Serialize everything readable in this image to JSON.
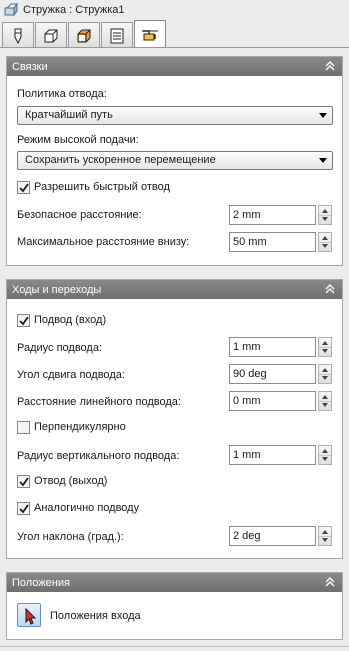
{
  "window": {
    "title": "Стружка : Стружка1"
  },
  "tabs": [
    {
      "icon": "tool-icon"
    },
    {
      "icon": "cube-icon"
    },
    {
      "icon": "stock-icon"
    },
    {
      "icon": "list-icon"
    },
    {
      "icon": "links-icon",
      "active": true
    }
  ],
  "links": {
    "title": "Связки",
    "retract_policy_label": "Политика отвода:",
    "retract_policy_value": "Кратчайший путь",
    "high_feed_label": "Режим высокой подачи:",
    "high_feed_value": "Сохранить ускоренное перемещение",
    "fast_retract_label": "Разрешить быстрый отвод",
    "fast_retract_checked": true,
    "safe_distance_label": "Безопасное расстояние:",
    "safe_distance_value": "2 mm",
    "max_down_label": "Максимальное расстояние внизу:",
    "max_down_value": "50 mm"
  },
  "leads": {
    "title": "Ходы и переходы",
    "lead_in_label": "Подвод (вход)",
    "lead_in_checked": true,
    "lead_radius_label": "Радиус подвода:",
    "lead_radius_value": "1 mm",
    "sweep_angle_label": "Угол сдвига подвода:",
    "sweep_angle_value": "90 deg",
    "linear_distance_label": "Расстояние линейного подвода:",
    "linear_distance_value": "0 mm",
    "perpendicular_label": "Перпендикулярно",
    "perpendicular_checked": false,
    "vertical_radius_label": "Радиус вертикального подвода:",
    "vertical_radius_value": "1 mm",
    "lead_out_label": "Отвод (выход)",
    "lead_out_checked": true,
    "same_as_lead_in_label": "Аналогично подводу",
    "same_as_lead_in_checked": true,
    "ramp_angle_label": "Угол наклона (град.):",
    "ramp_angle_value": "2 deg"
  },
  "positions": {
    "title": "Положения",
    "entry_positions_label": "Положения входа"
  },
  "colors": {
    "panel_header": "#7d7d7d",
    "background": "#ececec",
    "button_accent": "#bcd6ee",
    "cursor_red": "#d03030"
  }
}
